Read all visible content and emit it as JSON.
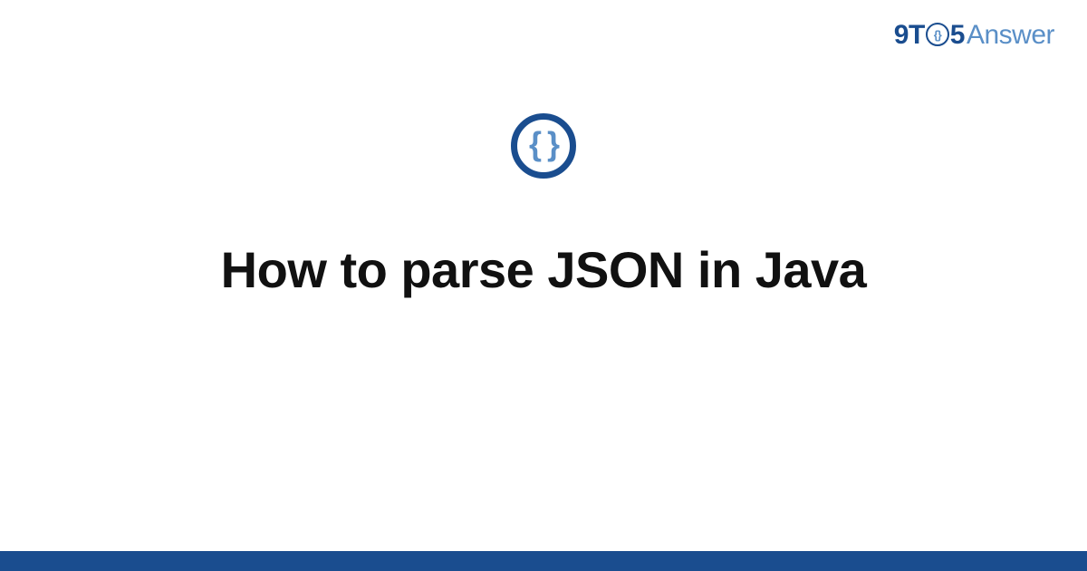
{
  "brand": {
    "part1": "9",
    "part2": "T",
    "o_inner": "{}",
    "part3": "5",
    "part4": "Answer"
  },
  "topic": {
    "icon_glyph": "{ }",
    "icon_name": "json-braces-icon"
  },
  "title": "How to parse JSON in Java",
  "colors": {
    "brand_dark": "#1a4d8f",
    "brand_light": "#5a8fc7",
    "text": "#111111",
    "background": "#ffffff"
  }
}
